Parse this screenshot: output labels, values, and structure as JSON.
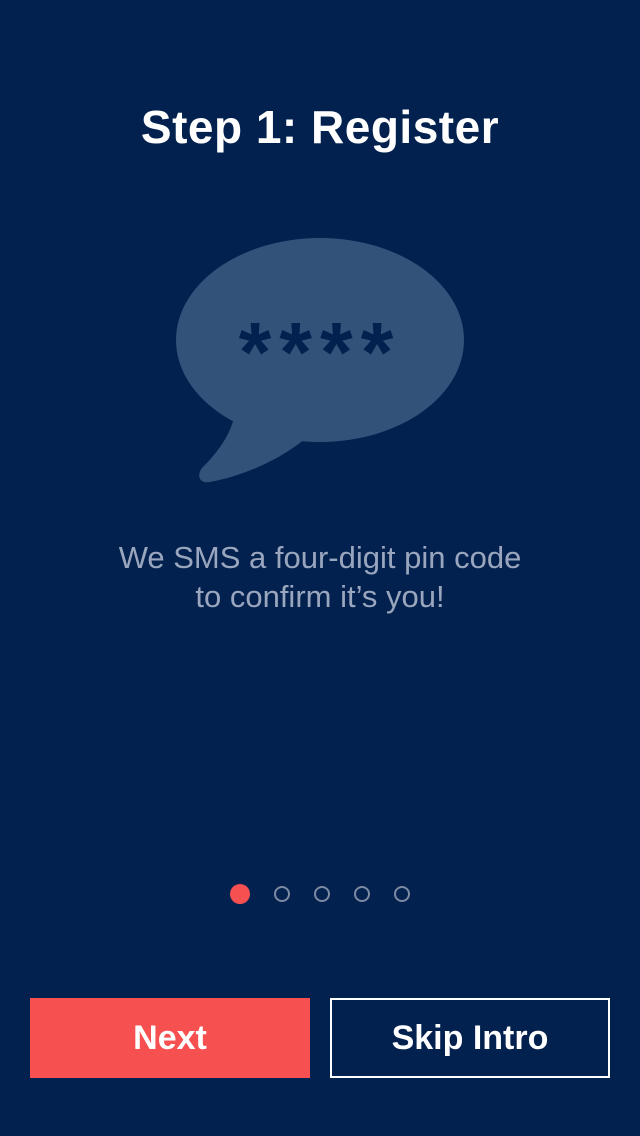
{
  "screen": {
    "title": "Step 1: Register",
    "description_line1": "We SMS a four-digit pin code",
    "description_line2": "to confirm it’s you!"
  },
  "illustration": {
    "icon": "speech-bubble-icon",
    "masked_pin": "****",
    "bubble_color": "#33527a"
  },
  "pager": {
    "total": 5,
    "current": 1,
    "active_color": "#f65051"
  },
  "buttons": {
    "next_label": "Next",
    "skip_label": "Skip Intro"
  },
  "colors": {
    "background": "#02214f",
    "accent": "#f65051",
    "text_muted": "#9aa6bd"
  }
}
